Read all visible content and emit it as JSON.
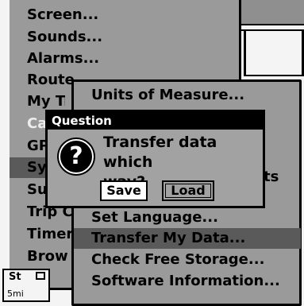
{
  "main_menu": {
    "items": [
      {
        "label": "Screen...",
        "state": "normal"
      },
      {
        "label": "Sounds...",
        "state": "normal"
      },
      {
        "label": "Alarms...",
        "state": "normal"
      },
      {
        "label": "Route Planning...",
        "state": "normal"
      },
      {
        "label": "My Trails...",
        "state": "normal"
      },
      {
        "label": "Ca",
        "state": "disabled"
      },
      {
        "label": "GP",
        "state": "normal"
      },
      {
        "label": "Sy",
        "state": "selected"
      },
      {
        "label": "Su",
        "state": "normal"
      },
      {
        "label": "Trip C",
        "state": "normal"
      },
      {
        "label": "Timer",
        "state": "normal"
      },
      {
        "label": "Brow",
        "state": "normal"
      }
    ]
  },
  "sub_menu": {
    "items": [
      {
        "label": "Units of Measure...",
        "state": "normal"
      },
      {
        "label": "Set Language...",
        "state": "normal"
      },
      {
        "label": "Transfer My Data...",
        "state": "selected"
      },
      {
        "label": "Check Free Storage...",
        "state": "normal"
      },
      {
        "label": "Software Information...",
        "state": "normal"
      }
    ],
    "partial_hidden": "ts"
  },
  "dialog": {
    "title": "Question",
    "icon": "question-icon",
    "message_line1": "Transfer data which",
    "message_line2": "way?",
    "save_label": "Save",
    "load_label": "Load"
  },
  "status": {
    "text": "St",
    "scale": "5mi"
  },
  "colors": {
    "menu_bg": "#9a9a9a",
    "selected_bg": "#5a5a5a",
    "disabled_text": "#ededed",
    "title_bar": "#000000"
  }
}
